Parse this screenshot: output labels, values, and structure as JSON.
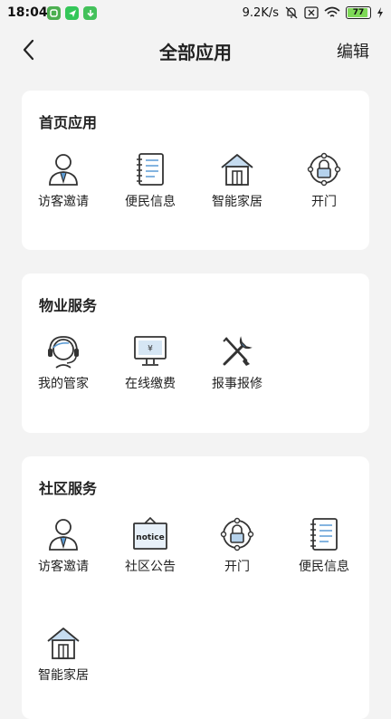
{
  "status": {
    "time": "18:04",
    "speed": "9.2K/s",
    "battery": "77"
  },
  "nav": {
    "title": "全部应用",
    "edit": "编辑"
  },
  "sections": [
    {
      "title": "首页应用",
      "items": [
        {
          "label": "访客邀请",
          "icon": "visitor-icon"
        },
        {
          "label": "便民信息",
          "icon": "notebook-icon"
        },
        {
          "label": "智能家居",
          "icon": "smart-home-icon"
        },
        {
          "label": "开门",
          "icon": "door-lock-icon"
        }
      ]
    },
    {
      "title": "物业服务",
      "items": [
        {
          "label": "我的管家",
          "icon": "headset-butler-icon"
        },
        {
          "label": "在线缴费",
          "icon": "monitor-payment-icon"
        },
        {
          "label": "报事报修",
          "icon": "repair-tools-icon"
        }
      ]
    },
    {
      "title": "社区服务",
      "items": [
        {
          "label": "访客邀请",
          "icon": "visitor-icon"
        },
        {
          "label": "社区公告",
          "icon": "notice-board-icon"
        },
        {
          "label": "开门",
          "icon": "door-lock-icon"
        },
        {
          "label": "便民信息",
          "icon": "notebook-icon"
        },
        {
          "label": "智能家居",
          "icon": "smart-home-icon"
        }
      ]
    }
  ],
  "notice_sign_text": "notice",
  "yen_symbol": "¥",
  "colors": {
    "background": "#f3f3f3",
    "card": "#ffffff",
    "icon_stroke": "#333333",
    "icon_accent": "#5b9bd5"
  }
}
